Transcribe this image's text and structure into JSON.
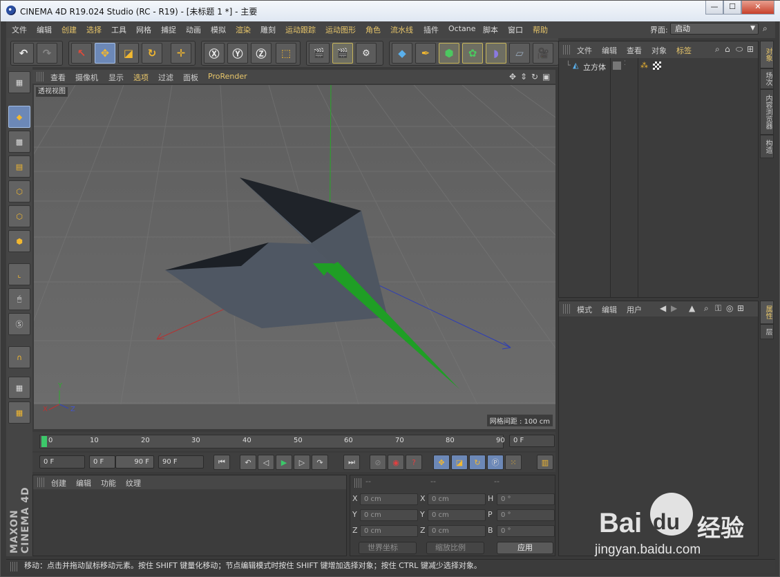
{
  "window": {
    "title": "CINEMA 4D R19.024 Studio (RC - R19) - [未标题 1 *] - 主要",
    "minimize": "—",
    "maximize": "☐",
    "close": "✕"
  },
  "menu": {
    "items": [
      "文件",
      "编辑",
      "创建",
      "选择",
      "工具",
      "网格",
      "捕捉",
      "动画",
      "模拟",
      "渲染",
      "雕刻",
      "运动跟踪",
      "运动图形",
      "角色",
      "流水线",
      "插件",
      "Octane",
      "脚本",
      "窗口",
      "帮助"
    ],
    "layout_label": "界面:",
    "layout_value": "启动"
  },
  "viewport": {
    "menu": [
      "查看",
      "摄像机",
      "显示",
      "选项",
      "过滤",
      "面板",
      "ProRender"
    ],
    "label": "透视视图",
    "grid_spacing": "网格间距 : 100 cm",
    "axes": {
      "x": "X",
      "y": "Y",
      "z": "Z"
    }
  },
  "timeline": {
    "ticks": [
      "0",
      "10",
      "20",
      "30",
      "40",
      "50",
      "60",
      "70",
      "80",
      "90"
    ],
    "current_frame": "0 F"
  },
  "transport": {
    "start": "0 F",
    "range_start": "0 F",
    "range_end": "90 F",
    "end": "90 F"
  },
  "material": {
    "menu": [
      "创建",
      "编辑",
      "功能",
      "纹理"
    ]
  },
  "coords": {
    "headers": [
      "--",
      "--",
      "--"
    ],
    "rows": [
      {
        "a": "X",
        "av": "0 cm",
        "b": "X",
        "bv": "0 cm",
        "c": "H",
        "cv": "0 °"
      },
      {
        "a": "Y",
        "av": "0 cm",
        "b": "Y",
        "bv": "0 cm",
        "c": "P",
        "cv": "0 °"
      },
      {
        "a": "Z",
        "av": "0 cm",
        "b": "Z",
        "bv": "0 cm",
        "c": "B",
        "cv": "0 °"
      }
    ],
    "world": "世界坐标",
    "scale": "缩放比例",
    "apply": "应用"
  },
  "objects": {
    "menu": [
      "文件",
      "编辑",
      "查看",
      "对象",
      "标签"
    ],
    "item": "立方体"
  },
  "attributes": {
    "menu": [
      "模式",
      "编辑",
      "用户"
    ]
  },
  "right_tabs": [
    "对象",
    "场次",
    "内容浏览器",
    "构造"
  ],
  "attr_tabs": [
    "属性",
    "层"
  ],
  "branding": "MAXON CINEMA 4D",
  "status": "移动：点击并拖动鼠标移动元素。按住 SHIFT 键量化移动；节点编辑模式时按住 SHIFT 键增加选择对象；按住 CTRL 键减少选择对象。",
  "watermark": {
    "brand": "Bai",
    "brand2": "du",
    "suffix": "经验",
    "url": "jingyan.baidu.com"
  },
  "colors": {
    "accent": "#6c88b7",
    "highlight": "#e8c66a",
    "viewport": "#666666",
    "mesh": "#4f5763"
  }
}
